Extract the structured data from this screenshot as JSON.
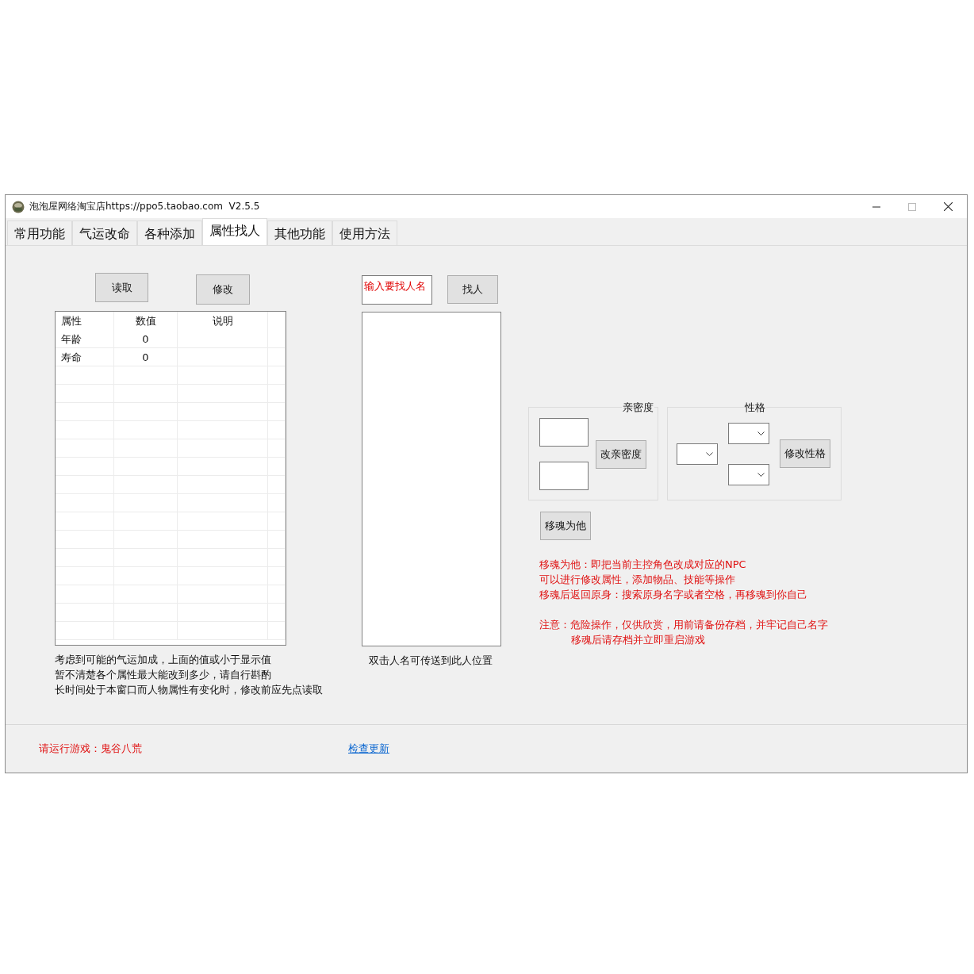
{
  "window": {
    "title": "泡泡屋网络淘宝店https://ppo5.taobao.com  V2.5.5"
  },
  "tabs": [
    {
      "label": "常用功能",
      "selected": false
    },
    {
      "label": "气运改命",
      "selected": false
    },
    {
      "label": "各种添加",
      "selected": false
    },
    {
      "label": "属性找人",
      "selected": true
    },
    {
      "label": "其他功能",
      "selected": false
    },
    {
      "label": "使用方法",
      "selected": false
    }
  ],
  "attributes": {
    "read_button": "读取",
    "modify_button": "修改",
    "table": {
      "columns": [
        "属性",
        "数值",
        "说明"
      ],
      "rows": [
        {
          "attribute": "年龄",
          "value": "0"
        },
        {
          "attribute": "寿命",
          "value": "0"
        }
      ]
    },
    "notes": [
      "考虑到可能的气运加成，上面的值或小于显示值",
      "暂不清楚各个属性最大能改到多少，请自行斟酌",
      "长时间处于本窗口而人物属性有变化时，修改前应先点读取"
    ]
  },
  "search": {
    "placeholder": "输入要找人名",
    "find_button": "找人",
    "hint": "双击人名可传送到此人位置"
  },
  "intimacy": {
    "title": "亲密度",
    "button": "改亲密度"
  },
  "personality": {
    "title": "性格",
    "button": "修改性格"
  },
  "possess_button": "移魂为他",
  "warnings": [
    {
      "hanging": false,
      "lines": [
        "移魂为他：即把当前主控角色改成对应的NPC",
        "可以进行修改属性，添加物品、技能等操作",
        "移魂后返回原身：搜索原身名字或者空格，再移魂到你自己"
      ]
    },
    {
      "hanging": true,
      "lines": [
        "注意：危险操作，仅供欣赏，用前请备份存档，并牢记自己名字",
        "移魂后请存档并立即重启游戏"
      ]
    }
  ],
  "status": {
    "game": "请运行游戏：鬼谷八荒",
    "update_link": "检查更新"
  }
}
